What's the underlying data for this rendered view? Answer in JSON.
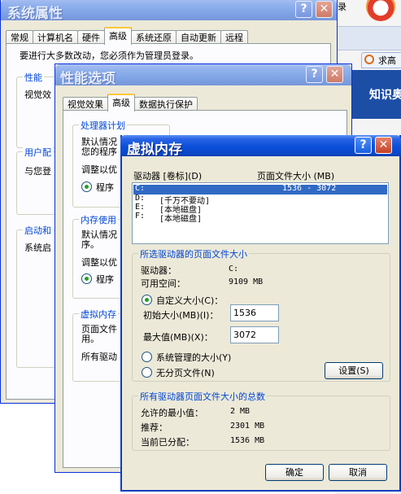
{
  "sys": {
    "title": "系统属性",
    "tabs": [
      "常规",
      "计算机名",
      "硬件",
      "高级",
      "系统还原",
      "自动更新",
      "远程"
    ],
    "admin_note": "要进行大多数改动，您必须作为管理员登录。",
    "group_perf": "性能",
    "perf_text": "视觉效",
    "group_profile": "用户配",
    "profile_text": "与您登",
    "group_startup": "启动和",
    "startup_text": "系统启"
  },
  "browser": {
    "top_text": "录",
    "search_tab": "求高",
    "banner": "知识奥"
  },
  "perf": {
    "title": "性能选项",
    "tabs": [
      "视觉效果",
      "高级",
      "数据执行保护"
    ],
    "group_cpu": "处理器计划",
    "cpu_l1": "默认情况",
    "cpu_l2": "您的程序",
    "cpu_adjust": "调整以优",
    "cpu_radio": "程序",
    "group_mem": "内存使用",
    "mem_l1": "默认情况",
    "mem_l2": "序。",
    "mem_adjust": "调整以优",
    "mem_radio": "程序",
    "group_vm": "虚拟内存",
    "vm_l1": "页面文件",
    "vm_l2": "用。",
    "vm_l3": "所有驱动"
  },
  "vm": {
    "title": "虚拟内存",
    "col_drive": "驱动器 [卷标](D)",
    "col_size": "页面文件大小 (MB)",
    "drives": [
      {
        "drive": "C:",
        "label": "",
        "size": "1536 - 3072"
      },
      {
        "drive": "D:",
        "label": "[千万不要动]",
        "size": ""
      },
      {
        "drive": "E:",
        "label": "[本地磁盘]",
        "size": ""
      },
      {
        "drive": "F:",
        "label": "[本地磁盘]",
        "size": ""
      }
    ],
    "group_sel": "所选驱动器的页面文件大小",
    "drive_label": "驱动器：",
    "drive_value": "C:",
    "space_label": "可用空间：",
    "space_value": "9109 MB",
    "custom_label": "自定义大小(C)：",
    "initial_label": "初始大小(MB)(I)：",
    "initial_value": "1536",
    "max_label": "最大值(MB)(X)：",
    "max_value": "3072",
    "system_label": "系统管理的大小(Y)",
    "nopage_label": "无分页文件(N)",
    "set_button": "设置(S)",
    "group_total": "所有驱动器页面文件大小的总数",
    "min_label": "允许的最小值：",
    "min_value": "2 MB",
    "rec_label": "推荐：",
    "rec_value": "2301 MB",
    "cur_label": "当前已分配：",
    "cur_value": "1536 MB",
    "ok_button": "确定",
    "cancel_button": "取消"
  },
  "icons": {
    "help": "?",
    "close": "✕"
  }
}
